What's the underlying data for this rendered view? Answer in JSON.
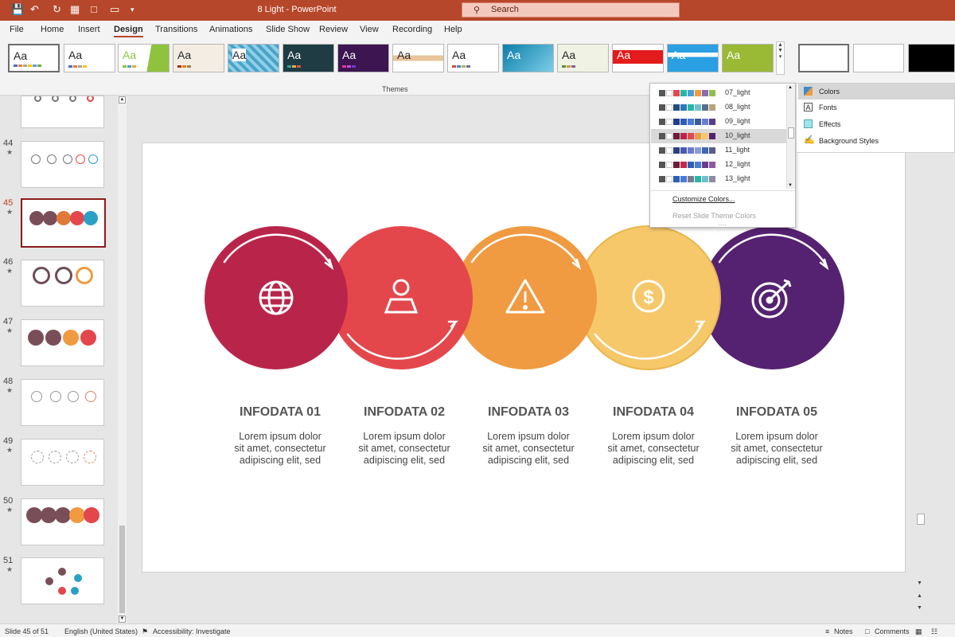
{
  "window": {
    "title": "8 Light  -  PowerPoint",
    "search_placeholder": "Search"
  },
  "tabs": [
    "File",
    "Home",
    "Insert",
    "Design",
    "Transitions",
    "Animations",
    "Slide Show",
    "Review",
    "View",
    "Recording",
    "Help"
  ],
  "active_tab": "Design",
  "ribbon": {
    "themes_label": "Themes",
    "theme_sample": "Aa"
  },
  "color_menu": {
    "items": [
      "07_light",
      "08_light",
      "09_light",
      "10_light",
      "11_light",
      "12_light",
      "13_light"
    ],
    "selected": "10_light",
    "customize": "Customize Colors...",
    "reset": "Reset Slide Theme Colors"
  },
  "variant_menu": {
    "items": [
      "Colors",
      "Fonts",
      "Effects",
      "Background Styles"
    ],
    "selected": "Colors"
  },
  "slide_pane": {
    "numbers": [
      "44",
      "45",
      "46",
      "47",
      "48",
      "49",
      "50",
      "51"
    ],
    "active": "45"
  },
  "slide": {
    "items": [
      {
        "title": "INFODATA 01",
        "lines": [
          "Lorem ipsum dolor",
          "sit amet, consectetur",
          "adipiscing elit, sed"
        ],
        "color": "#b9254a",
        "icon": "globe-icon"
      },
      {
        "title": "INFODATA 02",
        "lines": [
          "Lorem ipsum dolor",
          "sit amet, consectetur",
          "adipiscing elit, sed"
        ],
        "color": "#e3474c",
        "icon": "user-icon"
      },
      {
        "title": "INFODATA 03",
        "lines": [
          "Lorem ipsum dolor",
          "sit amet, consectetur",
          "adipiscing elit, sed"
        ],
        "color": "#f09a41",
        "icon": "warning-icon"
      },
      {
        "title": "INFODATA 04",
        "lines": [
          "Lorem ipsum dolor",
          "sit amet, consectetur",
          "adipiscing elit, sed"
        ],
        "color": "#f6c86a",
        "icon": "dollar-icon"
      },
      {
        "title": "INFODATA 05",
        "lines": [
          "Lorem ipsum dolor",
          "sit amet, consectetur",
          "adipiscing elit, sed"
        ],
        "color": "#552171",
        "icon": "target-icon"
      }
    ]
  },
  "status": {
    "slide": "Slide 45 of 51",
    "language": "English (United States)",
    "accessibility": "Accessibility: Investigate",
    "notes": "Notes",
    "comments": "Comments"
  }
}
